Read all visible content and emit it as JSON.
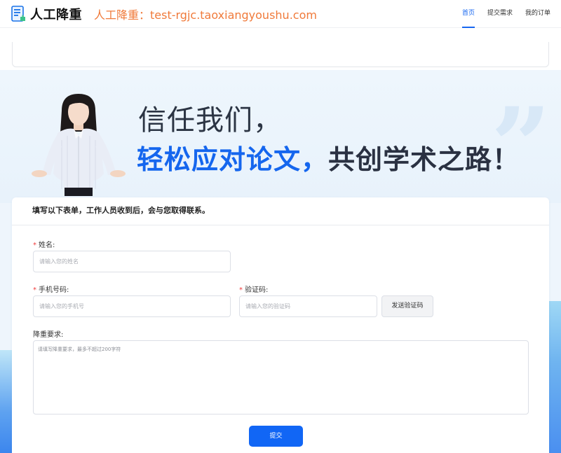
{
  "header": {
    "logo_name": "人工降重",
    "site_url": "人工降重：test-rgjc.taoxiangyoushu.com",
    "nav": [
      {
        "label": "首页",
        "active": true
      },
      {
        "label": "提交需求",
        "active": false
      },
      {
        "label": "我的订单",
        "active": false
      }
    ]
  },
  "hero": {
    "line1": "信任我们，",
    "line2_highlight": "轻松应对论文，",
    "line2_rest": "共创学术之路！"
  },
  "form": {
    "heading": "填写以下表单，工作人员收到后，会与您取得联系。",
    "required_mark": "*",
    "name_label": "姓名:",
    "name_placeholder": "请输入您的姓名",
    "phone_label": "手机号码:",
    "phone_placeholder": "请输入您的手机号",
    "code_label": "验证码:",
    "code_placeholder": "请输入您的验证码",
    "send_code_label": "发送验证码",
    "requirement_label": "降重要求:",
    "requirement_placeholder": "请填写降重要求，最多不超过200字符",
    "submit_label": "提交"
  },
  "colors": {
    "accent": "#1767f0",
    "url_orange": "#f07a3a",
    "required_red": "#f03b3b"
  }
}
